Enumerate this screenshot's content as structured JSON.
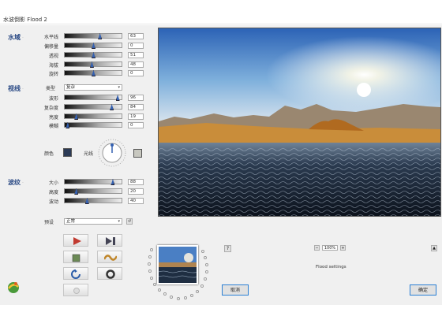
{
  "window": {
    "title": "水波倒影 Flood 2"
  },
  "water": {
    "heading": "水域",
    "controls": [
      {
        "label": "水平线",
        "value": "63",
        "pos": 0.62
      },
      {
        "label": "偏移量",
        "value": "0",
        "pos": 0.5
      },
      {
        "label": "透视",
        "value": "51",
        "pos": 0.5
      },
      {
        "label": "海拔",
        "value": "48",
        "pos": 0.47
      },
      {
        "label": "旋转",
        "value": "0",
        "pos": 0.5
      }
    ]
  },
  "waves": {
    "heading": "视线",
    "type_label": "类型",
    "type_value": "复杂",
    "controls": [
      {
        "label": "波形",
        "value": "96",
        "pos": 0.95
      },
      {
        "label": "复杂度",
        "value": "84",
        "pos": 0.84
      },
      {
        "label": "亮度",
        "value": "19",
        "pos": 0.18
      },
      {
        "label": "模糊",
        "value": "0",
        "pos": 0.02
      }
    ]
  },
  "colors": {
    "color_label": "颜色",
    "light_label": "光线",
    "water_color": "#2b3a55",
    "light_color": "#c8c8c0"
  },
  "ripples": {
    "heading": "波纹",
    "controls": [
      {
        "label": "大小",
        "value": "88",
        "pos": 0.86
      },
      {
        "label": "高度",
        "value": "20",
        "pos": 0.18
      },
      {
        "label": "波动",
        "value": "40",
        "pos": 0.38
      }
    ]
  },
  "preset": {
    "label": "预设",
    "value": "正常",
    "reset_label": "↺"
  },
  "zoom": {
    "minus": "−",
    "value": "100%",
    "plus": "+"
  },
  "help": {
    "label": "?"
  },
  "expand": {
    "label": "▲"
  },
  "status": {
    "text": "Flood settings"
  },
  "buttons": {
    "cancel": "取消",
    "ok": "确定"
  }
}
